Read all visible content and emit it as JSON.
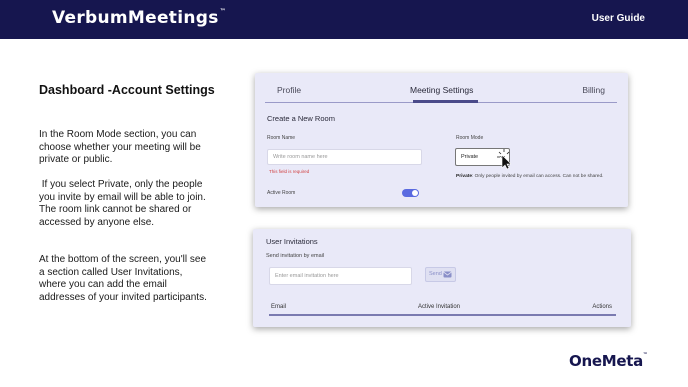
{
  "header": {
    "logo": "VerbumMeetings",
    "logo_tm": "™",
    "user_guide": "User Guide"
  },
  "content": {
    "heading": "Dashboard -Account Settings",
    "paragraph1": "In the Room Mode section, you can choose whether your meeting will be private or public.",
    "paragraph2": " If you select Private, only the people you invite by email will be able to join. The room link cannot be shared or accessed by anyone else.",
    "paragraph3": "At the bottom of the screen, you'll see a section called User Invitations, where you can add the email addresses of your invited participants."
  },
  "settings_card": {
    "tabs": [
      "Profile",
      "Meeting Settings",
      "Billing"
    ],
    "active_tab": "Meeting Settings",
    "section_title": "Create a New Room",
    "room_name_label": "Room Name",
    "room_name_placeholder": "Write room name here",
    "room_name_error": "This field is required",
    "active_room_label": "Active Room",
    "active_room_on": true,
    "room_mode_label": "Room Mode",
    "room_mode_value": "Private",
    "room_mode_hint_bold": "Private",
    "room_mode_hint": ": Only people invited by email can access. Can not be shared."
  },
  "invitations_card": {
    "title": "User Invitations",
    "send_label": "Send invitation by email",
    "email_placeholder": "Enter email invitation here",
    "send_button": "Send",
    "columns": [
      "Email",
      "Active Invitation",
      "Actions"
    ]
  },
  "footer": {
    "brand": "OneMeta",
    "brand_tm": "™"
  },
  "colors": {
    "header_bg": "#16164f",
    "card_bg": "#e9e9f8",
    "toggle_on": "#5a6ae0",
    "error": "#d04040"
  }
}
